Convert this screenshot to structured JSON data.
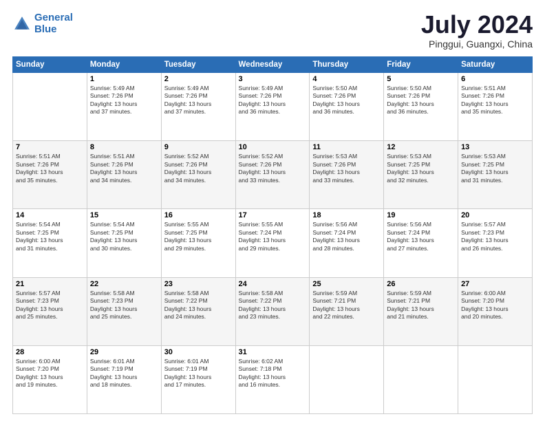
{
  "header": {
    "logo_line1": "General",
    "logo_line2": "Blue",
    "month": "July 2024",
    "location": "Pinggui, Guangxi, China"
  },
  "weekdays": [
    "Sunday",
    "Monday",
    "Tuesday",
    "Wednesday",
    "Thursday",
    "Friday",
    "Saturday"
  ],
  "weeks": [
    [
      {
        "day": "",
        "info": ""
      },
      {
        "day": "1",
        "info": "Sunrise: 5:49 AM\nSunset: 7:26 PM\nDaylight: 13 hours\nand 37 minutes."
      },
      {
        "day": "2",
        "info": "Sunrise: 5:49 AM\nSunset: 7:26 PM\nDaylight: 13 hours\nand 37 minutes."
      },
      {
        "day": "3",
        "info": "Sunrise: 5:49 AM\nSunset: 7:26 PM\nDaylight: 13 hours\nand 36 minutes."
      },
      {
        "day": "4",
        "info": "Sunrise: 5:50 AM\nSunset: 7:26 PM\nDaylight: 13 hours\nand 36 minutes."
      },
      {
        "day": "5",
        "info": "Sunrise: 5:50 AM\nSunset: 7:26 PM\nDaylight: 13 hours\nand 36 minutes."
      },
      {
        "day": "6",
        "info": "Sunrise: 5:51 AM\nSunset: 7:26 PM\nDaylight: 13 hours\nand 35 minutes."
      }
    ],
    [
      {
        "day": "7",
        "info": "Sunrise: 5:51 AM\nSunset: 7:26 PM\nDaylight: 13 hours\nand 35 minutes."
      },
      {
        "day": "8",
        "info": "Sunrise: 5:51 AM\nSunset: 7:26 PM\nDaylight: 13 hours\nand 34 minutes."
      },
      {
        "day": "9",
        "info": "Sunrise: 5:52 AM\nSunset: 7:26 PM\nDaylight: 13 hours\nand 34 minutes."
      },
      {
        "day": "10",
        "info": "Sunrise: 5:52 AM\nSunset: 7:26 PM\nDaylight: 13 hours\nand 33 minutes."
      },
      {
        "day": "11",
        "info": "Sunrise: 5:53 AM\nSunset: 7:26 PM\nDaylight: 13 hours\nand 33 minutes."
      },
      {
        "day": "12",
        "info": "Sunrise: 5:53 AM\nSunset: 7:25 PM\nDaylight: 13 hours\nand 32 minutes."
      },
      {
        "day": "13",
        "info": "Sunrise: 5:53 AM\nSunset: 7:25 PM\nDaylight: 13 hours\nand 31 minutes."
      }
    ],
    [
      {
        "day": "14",
        "info": "Sunrise: 5:54 AM\nSunset: 7:25 PM\nDaylight: 13 hours\nand 31 minutes."
      },
      {
        "day": "15",
        "info": "Sunrise: 5:54 AM\nSunset: 7:25 PM\nDaylight: 13 hours\nand 30 minutes."
      },
      {
        "day": "16",
        "info": "Sunrise: 5:55 AM\nSunset: 7:25 PM\nDaylight: 13 hours\nand 29 minutes."
      },
      {
        "day": "17",
        "info": "Sunrise: 5:55 AM\nSunset: 7:24 PM\nDaylight: 13 hours\nand 29 minutes."
      },
      {
        "day": "18",
        "info": "Sunrise: 5:56 AM\nSunset: 7:24 PM\nDaylight: 13 hours\nand 28 minutes."
      },
      {
        "day": "19",
        "info": "Sunrise: 5:56 AM\nSunset: 7:24 PM\nDaylight: 13 hours\nand 27 minutes."
      },
      {
        "day": "20",
        "info": "Sunrise: 5:57 AM\nSunset: 7:23 PM\nDaylight: 13 hours\nand 26 minutes."
      }
    ],
    [
      {
        "day": "21",
        "info": "Sunrise: 5:57 AM\nSunset: 7:23 PM\nDaylight: 13 hours\nand 25 minutes."
      },
      {
        "day": "22",
        "info": "Sunrise: 5:58 AM\nSunset: 7:23 PM\nDaylight: 13 hours\nand 25 minutes."
      },
      {
        "day": "23",
        "info": "Sunrise: 5:58 AM\nSunset: 7:22 PM\nDaylight: 13 hours\nand 24 minutes."
      },
      {
        "day": "24",
        "info": "Sunrise: 5:58 AM\nSunset: 7:22 PM\nDaylight: 13 hours\nand 23 minutes."
      },
      {
        "day": "25",
        "info": "Sunrise: 5:59 AM\nSunset: 7:21 PM\nDaylight: 13 hours\nand 22 minutes."
      },
      {
        "day": "26",
        "info": "Sunrise: 5:59 AM\nSunset: 7:21 PM\nDaylight: 13 hours\nand 21 minutes."
      },
      {
        "day": "27",
        "info": "Sunrise: 6:00 AM\nSunset: 7:20 PM\nDaylight: 13 hours\nand 20 minutes."
      }
    ],
    [
      {
        "day": "28",
        "info": "Sunrise: 6:00 AM\nSunset: 7:20 PM\nDaylight: 13 hours\nand 19 minutes."
      },
      {
        "day": "29",
        "info": "Sunrise: 6:01 AM\nSunset: 7:19 PM\nDaylight: 13 hours\nand 18 minutes."
      },
      {
        "day": "30",
        "info": "Sunrise: 6:01 AM\nSunset: 7:19 PM\nDaylight: 13 hours\nand 17 minutes."
      },
      {
        "day": "31",
        "info": "Sunrise: 6:02 AM\nSunset: 7:18 PM\nDaylight: 13 hours\nand 16 minutes."
      },
      {
        "day": "",
        "info": ""
      },
      {
        "day": "",
        "info": ""
      },
      {
        "day": "",
        "info": ""
      }
    ]
  ]
}
